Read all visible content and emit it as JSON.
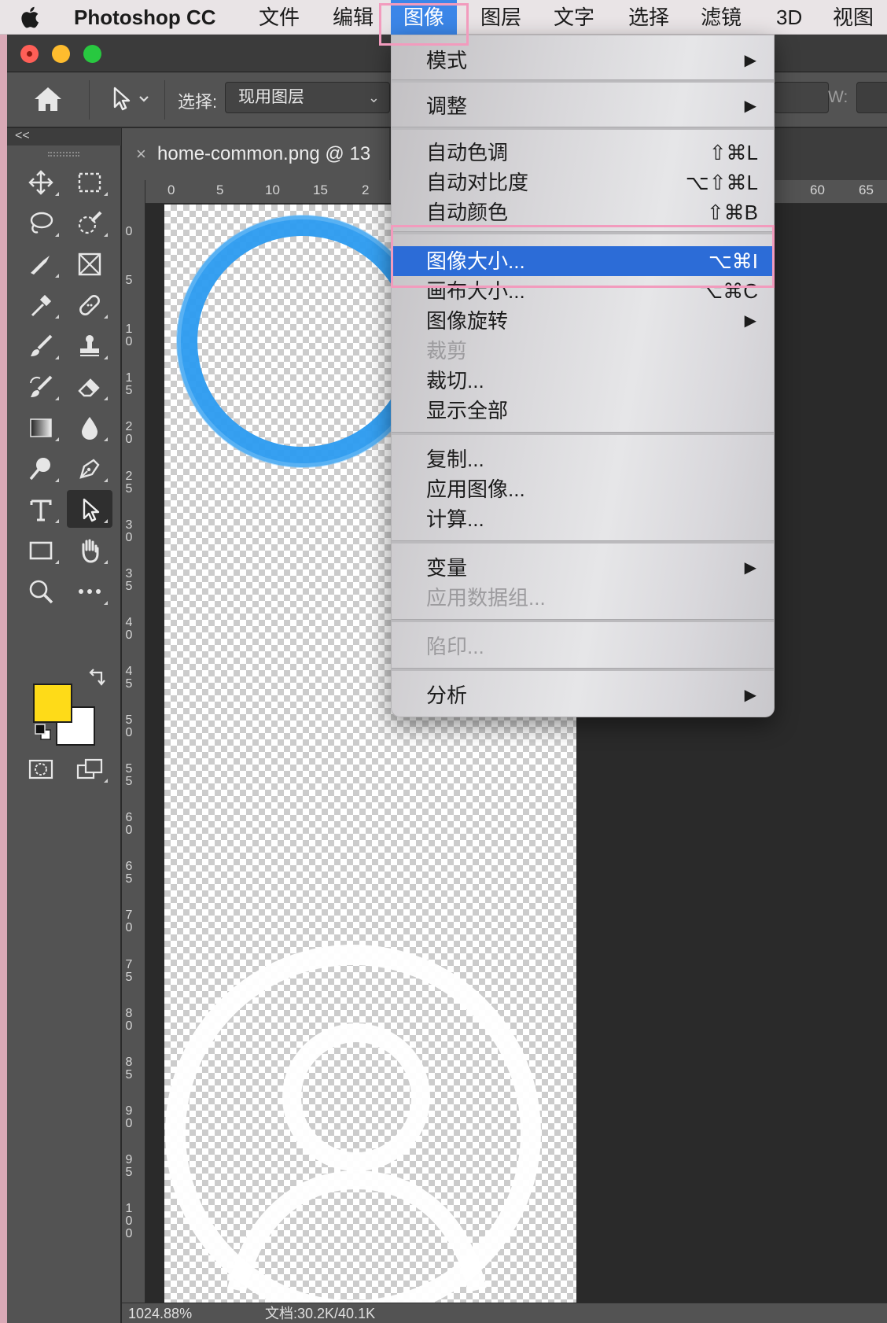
{
  "menubar": {
    "app_name": "Photoshop CC",
    "items": [
      "文件",
      "编辑",
      "图像",
      "图层",
      "文字",
      "选择",
      "滤镜",
      "3D",
      "视图"
    ],
    "active_item": "图像"
  },
  "options_bar": {
    "select_label": "选择:",
    "select_value": "现用图层",
    "w_label": "W:"
  },
  "toolbar": {
    "collapse_label": "<<",
    "foreground_color": "#fedb18",
    "background_color": "#ffffff"
  },
  "document": {
    "tab_title": "home-common.png @ 13",
    "close_label": "×"
  },
  "rulers": {
    "horizontal": [
      "0",
      "5",
      "10",
      "15",
      "2",
      "60",
      "65"
    ],
    "vertical": [
      "0",
      "5",
      "10",
      "15",
      "20",
      "25",
      "30",
      "35",
      "40",
      "45",
      "50",
      "55",
      "60",
      "65",
      "70",
      "75",
      "80",
      "85",
      "90",
      "95",
      "100"
    ]
  },
  "status_bar": {
    "zoom": "1024.88%",
    "doc_info": "文档:30.2K/40.1K"
  },
  "image_menu": {
    "items": [
      {
        "label": "模式",
        "submenu": true
      },
      {
        "label": "调整",
        "submenu": true
      },
      {
        "label": "自动色调",
        "shortcut": "⇧⌘L"
      },
      {
        "label": "自动对比度",
        "shortcut": "⌥⇧⌘L"
      },
      {
        "label": "自动颜色",
        "shortcut": "⇧⌘B"
      },
      {
        "label": "图像大小...",
        "shortcut": "⌥⌘I",
        "highlighted": true
      },
      {
        "label": "画布大小...",
        "shortcut": "⌥⌘C"
      },
      {
        "label": "图像旋转",
        "submenu": true
      },
      {
        "label": "裁剪",
        "disabled": true
      },
      {
        "label": "裁切..."
      },
      {
        "label": "显示全部"
      },
      {
        "label": "复制..."
      },
      {
        "label": "应用图像..."
      },
      {
        "label": "计算..."
      },
      {
        "label": "变量",
        "submenu": true
      },
      {
        "label": "应用数据组...",
        "disabled": true
      },
      {
        "label": "陷印...",
        "disabled": true
      },
      {
        "label": "分析",
        "submenu": true
      }
    ],
    "submenu_arrow": "▶"
  },
  "colors": {
    "highlight": "#2c6cd7",
    "menubar_active": "#3b86e8",
    "annotation_box": "#f29bbd",
    "icon_blue": "#2b9bf0"
  }
}
